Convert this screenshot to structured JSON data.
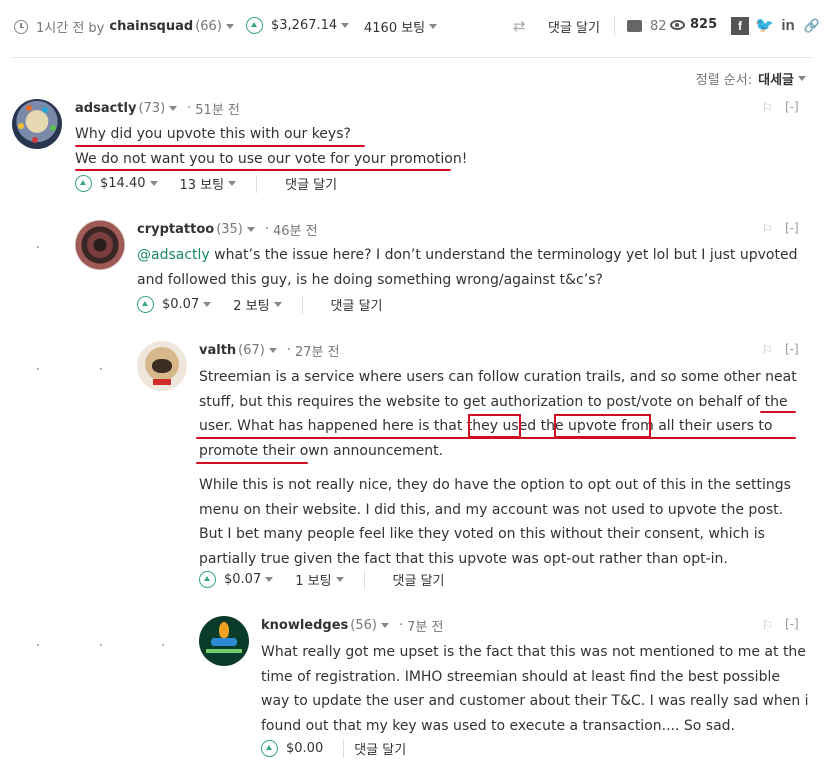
{
  "post_bar": {
    "time": "1시간 전 by",
    "author": "chainsquad",
    "rep": "(66)",
    "payout": "$3,267.14",
    "votes": "4160 보팅",
    "reply": "댓글 달기",
    "comments_count": "82",
    "views_count": "825"
  },
  "sort": {
    "label": "정렬 순서:",
    "value": "대세글"
  },
  "comments": [
    {
      "author": "adsactly",
      "rep": "(73)",
      "age": "51분 전",
      "paragraphs": [
        "Why did you upvote this with our keys?",
        "We do not want you to use our vote for your promotion!"
      ],
      "payout": "$14.40",
      "votes": "13 보팅",
      "reply": "댓글 달기",
      "collapse": "[-]"
    },
    {
      "author": "cryptattoo",
      "rep": "(35)",
      "age": "46분 전",
      "mention": "@adsactly",
      "text": " what’s the issue here? I don’t understand the terminology yet lol but I just upvoted and followed this guy, is he doing something wrong/against t&c’s?",
      "payout": "$0.07",
      "votes": "2 보팅",
      "reply": "댓글 달기",
      "collapse": "[-]"
    },
    {
      "author": "valth",
      "rep": "(67)",
      "age": "27분 전",
      "paragraphs": [
        "Streemian is a service where users can follow curation trails, and so some other neat stuff, but this requires the website to get authorization to post/vote on behalf of the user. What has happened here is that they used the upvote from all their users to promote their own announcement.",
        "While this is not really nice, they do have the option to opt out of this in the settings menu on their website. I did this, and my account was not used to upvote the post. But I bet many people feel like they voted on this without their consent, which is partially true given the fact that this upvote was opt-out rather than opt-in."
      ],
      "payout": "$0.07",
      "votes": "1 보팅",
      "reply": "댓글 달기",
      "collapse": "[-]"
    },
    {
      "author": "knowledges",
      "rep": "(56)",
      "age": "7분 전",
      "paragraphs": [
        "What really got me upset is the fact that this was not mentioned to me at the time of registration. IMHO streemian should at least find the best possible way to update the user and customer about their T&C. I was really sad when i found out that my key was used to execute a transaction.... So sad."
      ],
      "payout": "$0.00",
      "reply": "댓글 달기",
      "collapse": "[-]"
    }
  ],
  "icons": {
    "facebook": "f",
    "twitter": "🐦",
    "linkedin": "in",
    "upvote_color": "#3aa77c",
    "annotation_color": "#d01020"
  }
}
